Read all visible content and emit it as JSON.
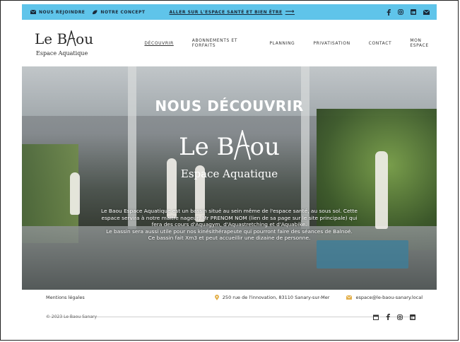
{
  "topbar": {
    "join": "NOUS REJOINDRE",
    "concept": "NOTRE CONCEPT",
    "cta": "ALLER SUR L'ESPACE SANTÉ ET BIEN ÊTRE",
    "arrow": "⟶"
  },
  "logo": {
    "name_before": "Le B",
    "name_after": "ou",
    "subtitle": "Espace Aquatique"
  },
  "nav": [
    "DÉCOUVRIR",
    "ABONNEMENTS ET FORFAITS",
    "PLANNING",
    "PRIVATISATION",
    "CONTACT",
    "MON ESPACE"
  ],
  "hero": {
    "title": "NOUS DÉCOUVRIR",
    "logo_before": "Le B",
    "logo_after": "ou",
    "logo_sub": "Espace Aquatique",
    "desc1": "Le Baou Espace Aquatique est un bassin situé au sein même de l'espace santé, au sous sol. Cette espace servira à notre maitre nageur, Mr PRENOM NOM (lien de sa page sur le site principale) qui fera des cours d'Aquagym, d'Aquastretching et d'Aquabike.",
    "desc2": "Le bassin sera aussi utile pour nos kinésithérapeute qui pourront faire des séances de Balnoé.",
    "desc3": "Ce bassin fait Xm3 et peut accueillir une dizaine de personne."
  },
  "footer": {
    "legal": "Mentions légales",
    "address": "250 rue de l'innovation, 83110 Sanary-sur-Mer",
    "email": "espace@le-baou-sanary.local",
    "copyright": "© 2023 Le Baou Sanary"
  },
  "colors": {
    "topbar": "#5fc4ea",
    "accent_pin": "#e3b04b"
  }
}
